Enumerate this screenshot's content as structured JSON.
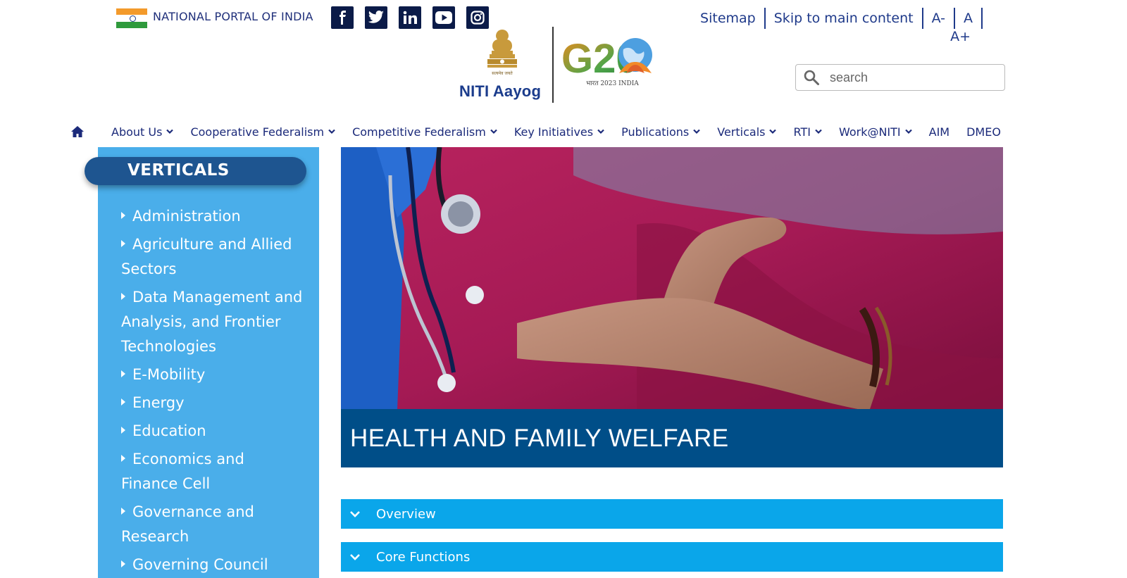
{
  "topbar": {
    "portal_label": "NATIONAL PORTAL OF INDIA",
    "social": [
      {
        "name": "facebook-icon",
        "glyph": "f"
      },
      {
        "name": "twitter-icon",
        "glyph": ""
      },
      {
        "name": "linkedin-icon",
        "glyph": "in"
      },
      {
        "name": "youtube-icon",
        "glyph": ""
      },
      {
        "name": "instagram-icon",
        "glyph": ""
      }
    ],
    "utility_links": [
      "Sitemap",
      "Skip to main content",
      "A-",
      "A",
      "A+"
    ]
  },
  "logo": {
    "emblem_motto": "सत्यमेव जयते",
    "niti": "NITI Aayog",
    "g20_text": "G20",
    "g20_sub": "भारत 2023 INDIA"
  },
  "search": {
    "placeholder": "search"
  },
  "nav": {
    "items": [
      "About Us",
      "Cooperative Federalism",
      "Competitive Federalism",
      "Key Initiatives",
      "Publications",
      "Verticals",
      "RTI",
      "Work@NITI",
      "AIM",
      "DMEO"
    ]
  },
  "sidebar": {
    "title": "VERTICALS",
    "items": [
      "Administration",
      "Agriculture and Allied Sectors",
      "Data Management and Analysis, and Frontier Technologies",
      "E-Mobility",
      "Energy",
      "Education",
      "Economics and Finance Cell",
      "Governance and Research",
      "Governing Council"
    ]
  },
  "hero": {
    "title": "HEALTH AND FAMILY WELFARE"
  },
  "accordion": [
    {
      "label": "Overview"
    },
    {
      "label": "Core Functions"
    }
  ],
  "colors": {
    "nav_text": "#1b2a6b",
    "sidebar_bg": "#4aaeea",
    "pill_bg": "#1e5590",
    "hero_band": "#004e88",
    "accordion_bg": "#0aa6ea"
  }
}
